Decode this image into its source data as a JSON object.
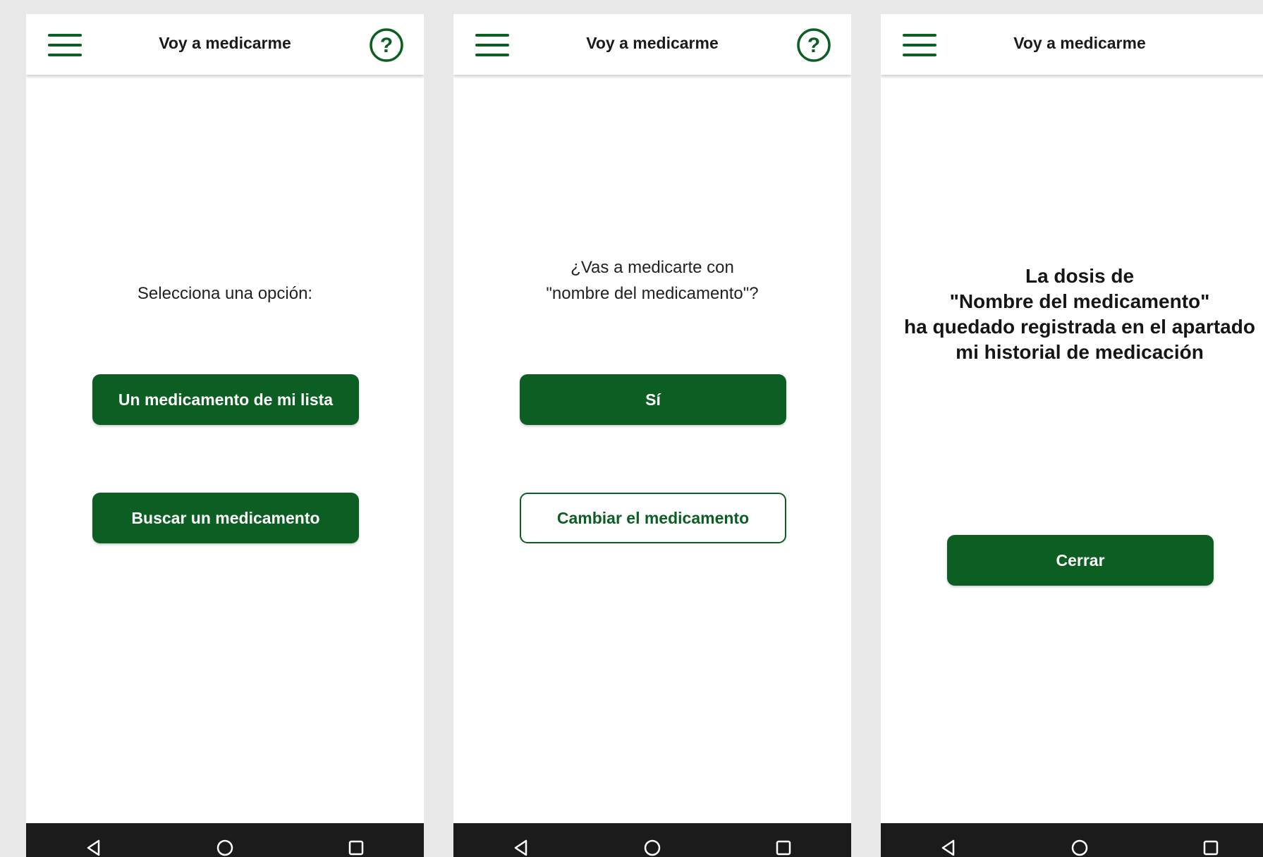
{
  "colors": {
    "primary_green": "#0c5e22",
    "background": "#e8e8e8",
    "navbar": "#1b1b1b"
  },
  "screens": [
    {
      "topbar": {
        "title": "Voy a medicarme",
        "menu_icon": "hamburger-menu-icon",
        "help_icon": "question-circle-icon"
      },
      "prompt": "Selecciona una opción:",
      "buttons": [
        {
          "label": "Un medicamento de mi lista",
          "style": "filled"
        },
        {
          "label": "Buscar un medicamento",
          "style": "filled"
        }
      ],
      "navbar": {
        "icons": [
          "back-triangle-icon",
          "home-circle-icon",
          "recents-square-icon"
        ]
      }
    },
    {
      "topbar": {
        "title": "Voy a medicarme",
        "menu_icon": "hamburger-menu-icon",
        "help_icon": "question-circle-icon"
      },
      "prompt_lines": [
        "¿Vas a medicarte con",
        "\"nombre del medicamento\"?"
      ],
      "buttons": [
        {
          "label": "Sí",
          "style": "filled"
        },
        {
          "label": "Cambiar el medicamento",
          "style": "outline"
        }
      ],
      "navbar": {
        "icons": [
          "back-triangle-icon",
          "home-circle-icon",
          "recents-square-icon"
        ]
      }
    },
    {
      "topbar": {
        "title": "Voy a medicarme",
        "menu_icon": "hamburger-menu-icon"
      },
      "message_lines": [
        "La dosis de",
        "\"Nombre del medicamento\"",
        "ha quedado registrada en el apartado",
        "mi historial de medicación"
      ],
      "buttons": [
        {
          "label": "Cerrar",
          "style": "filled"
        }
      ],
      "navbar": {
        "icons": [
          "back-triangle-icon",
          "home-circle-icon",
          "recents-square-icon"
        ]
      }
    }
  ]
}
